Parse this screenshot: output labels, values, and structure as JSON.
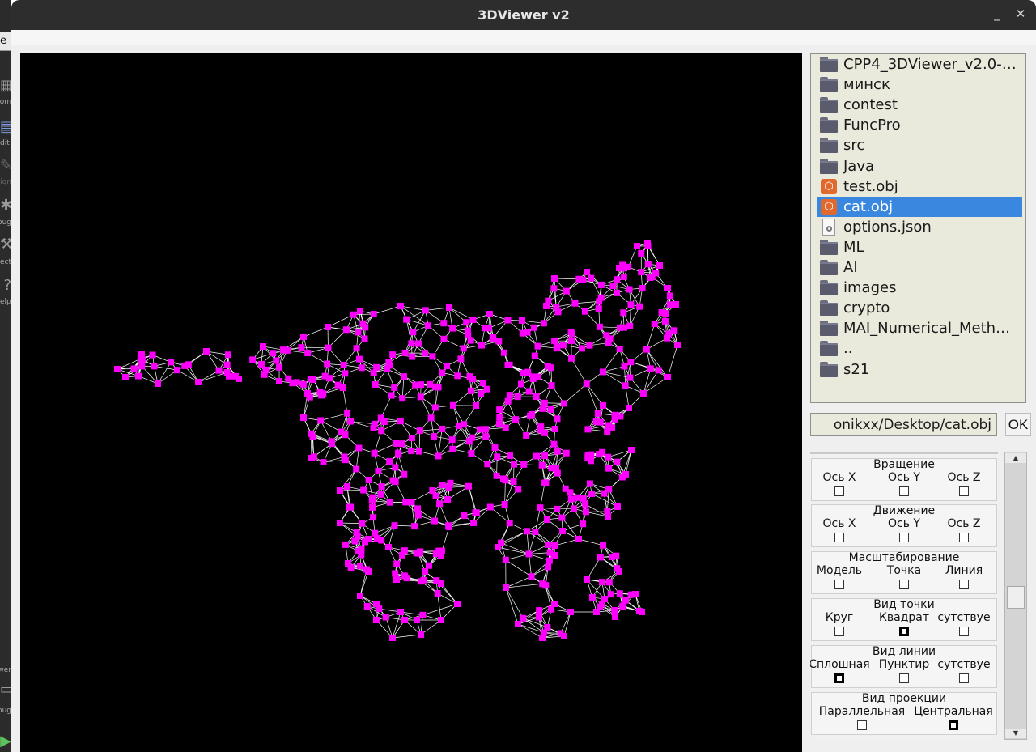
{
  "window": {
    "title": "3DViewer v2",
    "controls": {
      "minimize": "_",
      "close": "✕"
    }
  },
  "ide_sidebar": {
    "tab": "e",
    "items": [
      {
        "icon": "grid-icon",
        "label": "com"
      },
      {
        "icon": "edit-icon",
        "label": "dit"
      },
      {
        "icon": "pencil-icon",
        "label": "sign"
      },
      {
        "icon": "bug-icon",
        "label": "bug"
      },
      {
        "icon": "wrench-icon",
        "label": "ject"
      },
      {
        "icon": "help-icon",
        "label": "elp"
      },
      {
        "icon": "monitor-icon",
        "label": "ewer"
      },
      {
        "icon": "monitor-icon",
        "label": "bug"
      }
    ]
  },
  "file_browser": {
    "items": [
      {
        "name": "CPP4_3DViewer_v2.0-…",
        "type": "folder",
        "selected": false
      },
      {
        "name": "минск",
        "type": "folder",
        "selected": false
      },
      {
        "name": "contest",
        "type": "folder",
        "selected": false
      },
      {
        "name": "FuncPro",
        "type": "folder",
        "selected": false
      },
      {
        "name": "src",
        "type": "folder",
        "selected": false
      },
      {
        "name": "Java",
        "type": "folder",
        "selected": false
      },
      {
        "name": "test.obj",
        "type": "obj",
        "selected": false
      },
      {
        "name": "cat.obj",
        "type": "obj",
        "selected": true
      },
      {
        "name": "options.json",
        "type": "json",
        "selected": false
      },
      {
        "name": "ML",
        "type": "folder",
        "selected": false
      },
      {
        "name": "AI",
        "type": "folder",
        "selected": false
      },
      {
        "name": "images",
        "type": "folder",
        "selected": false
      },
      {
        "name": "crypto",
        "type": "folder",
        "selected": false
      },
      {
        "name": "MAI_Numerical_Meth…",
        "type": "folder",
        "selected": false
      },
      {
        "name": "..",
        "type": "folder",
        "selected": false
      },
      {
        "name": "s21",
        "type": "folder",
        "selected": false
      }
    ]
  },
  "path": {
    "value": "onikxx/Desktop/cat.obj",
    "ok_label": "OK"
  },
  "settings": {
    "groups": [
      {
        "title": "Вращение",
        "options": [
          {
            "label": "Ось X",
            "checked": false
          },
          {
            "label": "Ось Y",
            "checked": false
          },
          {
            "label": "Ось Z",
            "checked": false
          }
        ]
      },
      {
        "title": "Движение",
        "options": [
          {
            "label": "Ось X",
            "checked": false
          },
          {
            "label": "Ось Y",
            "checked": false
          },
          {
            "label": "Ось Z",
            "checked": false
          }
        ]
      },
      {
        "title": "Масштабирование",
        "options": [
          {
            "label": "Модель",
            "checked": false
          },
          {
            "label": "Точка",
            "checked": false
          },
          {
            "label": "Линия",
            "checked": false
          }
        ]
      },
      {
        "title": "Вид точки",
        "options": [
          {
            "label": "Круг",
            "checked": false
          },
          {
            "label": "Квадрат",
            "checked": true
          },
          {
            "label": "сутствуе",
            "checked": false
          }
        ]
      },
      {
        "title": "Вид линии",
        "options": [
          {
            "label": "Сплошная",
            "checked": true
          },
          {
            "label": "Пунктир",
            "checked": false
          },
          {
            "label": "сутствуе",
            "checked": false
          }
        ]
      },
      {
        "title": "Вид проекции",
        "options": [
          {
            "label": "Параллельная",
            "checked": false
          },
          {
            "label": "Центральная",
            "checked": true
          }
        ]
      }
    ]
  },
  "viewport": {
    "background": "#000000",
    "edge_color": "#ffffff",
    "vertex_color": "#ff00ff",
    "model": "cat.obj"
  }
}
